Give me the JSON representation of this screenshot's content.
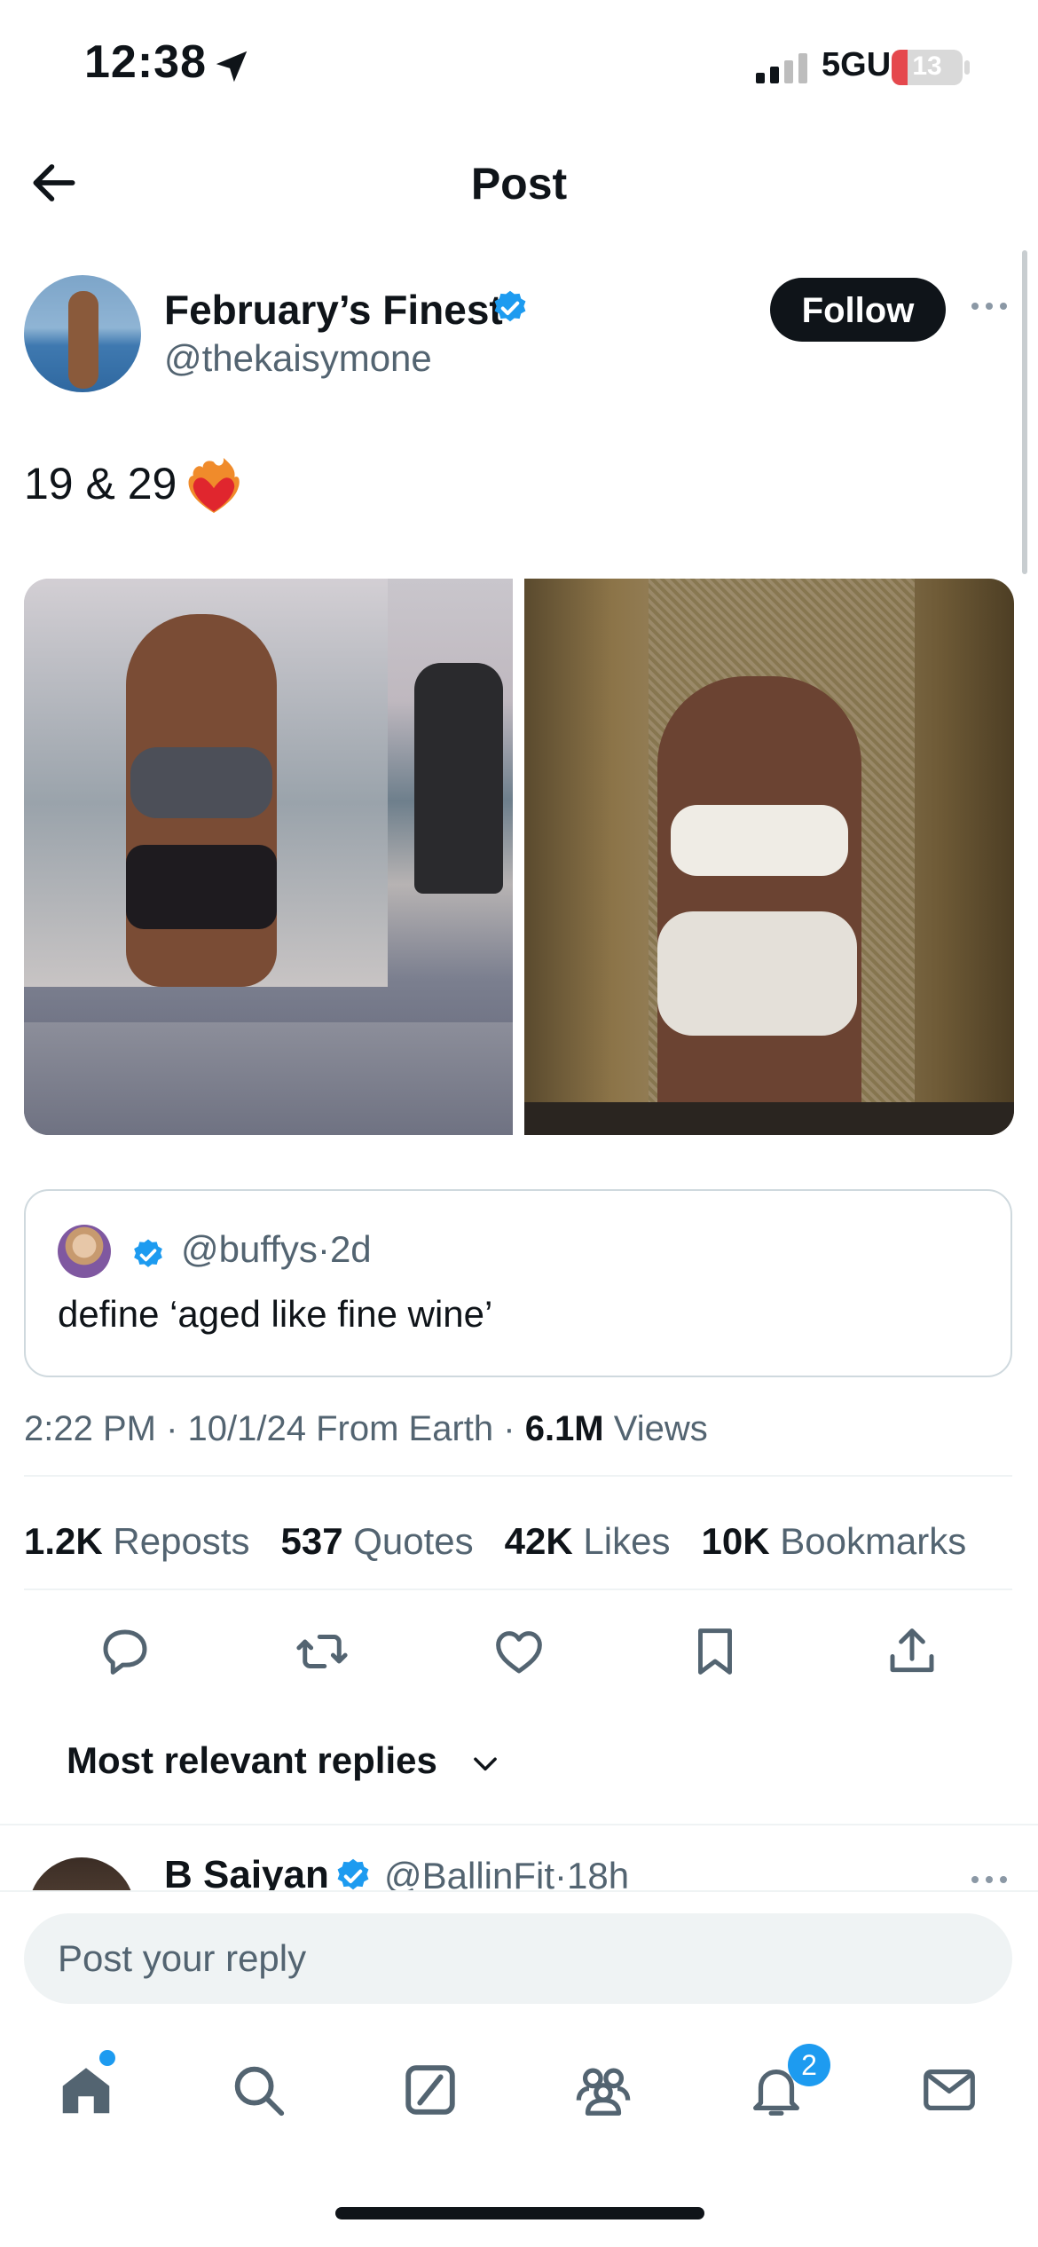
{
  "status_bar": {
    "time": "12:38",
    "network": "5GUC",
    "battery": "13"
  },
  "header": {
    "title": "Post"
  },
  "author": {
    "name": "February’s Finest",
    "handle": "@thekaisymone",
    "follow_label": "Follow"
  },
  "tweet": {
    "text": "19 & 29"
  },
  "quote": {
    "handle": "@buffys",
    "separator": "·",
    "age": "2d",
    "text": "define ‘aged like fine wine’"
  },
  "meta": {
    "time": "2:22 PM",
    "date": "10/1/24",
    "from": "From Earth",
    "views_value": "6.1M",
    "views_label": "Views"
  },
  "stats": {
    "reposts_value": "1.2K",
    "reposts_label": "Reposts",
    "quotes_value": "537",
    "quotes_label": "Quotes",
    "likes_value": "42K",
    "likes_label": "Likes",
    "bookmarks_value": "10K",
    "bookmarks_label": "Bookmarks"
  },
  "actions": [
    "reply-icon",
    "repost-icon",
    "like-icon",
    "bookmark-icon",
    "share-icon"
  ],
  "sort": {
    "label": "Most relevant replies"
  },
  "reply_preview": {
    "name": "B Saiyan",
    "handle": "@BallinFit",
    "separator": "·",
    "age": "18h"
  },
  "composer": {
    "placeholder": "Post your reply"
  },
  "nav": {
    "notifications_badge": "2",
    "items": [
      "home-icon",
      "search-icon",
      "grok-icon",
      "communities-icon",
      "notifications-icon",
      "messages-icon"
    ]
  },
  "colors": {
    "accent": "#1d9bf0",
    "text": "#0f1419",
    "muted": "#536471",
    "border": "#cfd9de"
  }
}
